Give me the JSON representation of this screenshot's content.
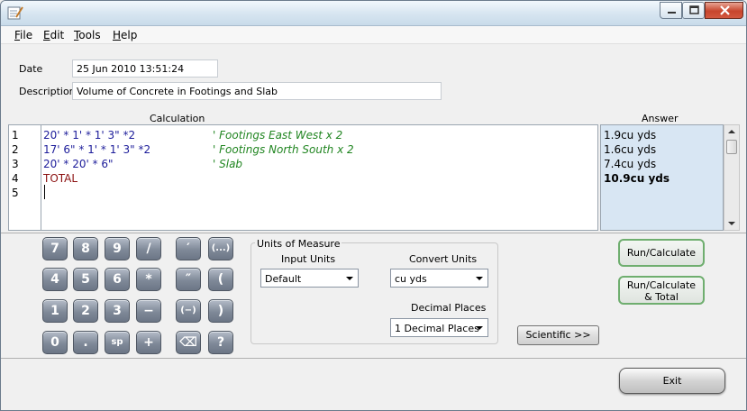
{
  "menu": {
    "file": "File",
    "file_u": "F",
    "file_rest": "ile",
    "edit_u": "E",
    "edit_rest": "dit",
    "tools_u": "T",
    "tools_rest": "ools",
    "help_u": "H",
    "help_rest": "elp"
  },
  "form": {
    "date_label": "Date",
    "date_value": "25 Jun 2010 13:51:24",
    "description_label": "Description",
    "description_value": "Volume of Concrete in Footings and Slab"
  },
  "calculation": {
    "header": "Calculation",
    "line_numbers": [
      "1",
      "2",
      "3",
      "4",
      "5"
    ],
    "lines": [
      {
        "expr": "20' * 1' * 1' 3\" *2",
        "comment": "' Footings East West x 2"
      },
      {
        "expr": "17' 6\" * 1' * 1' 3\" *2",
        "comment": "' Footings North South x 2"
      },
      {
        "expr": "20' * 20' * 6\"",
        "comment": "' Slab"
      },
      {
        "expr": "TOTAL",
        "comment": ""
      }
    ]
  },
  "answer": {
    "header": "Answer",
    "values": [
      "1.9cu yds",
      "1.6cu yds",
      "7.4cu yds",
      "10.9cu yds"
    ]
  },
  "keypad": {
    "row1": [
      "7",
      "8",
      "9",
      "/",
      "′",
      "(...)"
    ],
    "row2": [
      "4",
      "5",
      "6",
      "*",
      "″",
      "("
    ],
    "row3": [
      "1",
      "2",
      "3",
      "−",
      "(−)",
      ")"
    ],
    "row4": [
      "0",
      ".",
      "sp",
      "+",
      "⌫",
      "?"
    ]
  },
  "units": {
    "group_title": "Units of Measure",
    "input_label": "Input Units",
    "input_value": "Default",
    "convert_label": "Convert Units",
    "convert_value": "cu yds",
    "decimal_label": "Decimal Places",
    "decimal_value": "1 Decimal Places"
  },
  "buttons": {
    "run": "Run/Calculate",
    "run_total_1": "Run/Calculate",
    "run_total_2": "& Total",
    "scientific": "Scientific >>",
    "exit": "Exit"
  }
}
